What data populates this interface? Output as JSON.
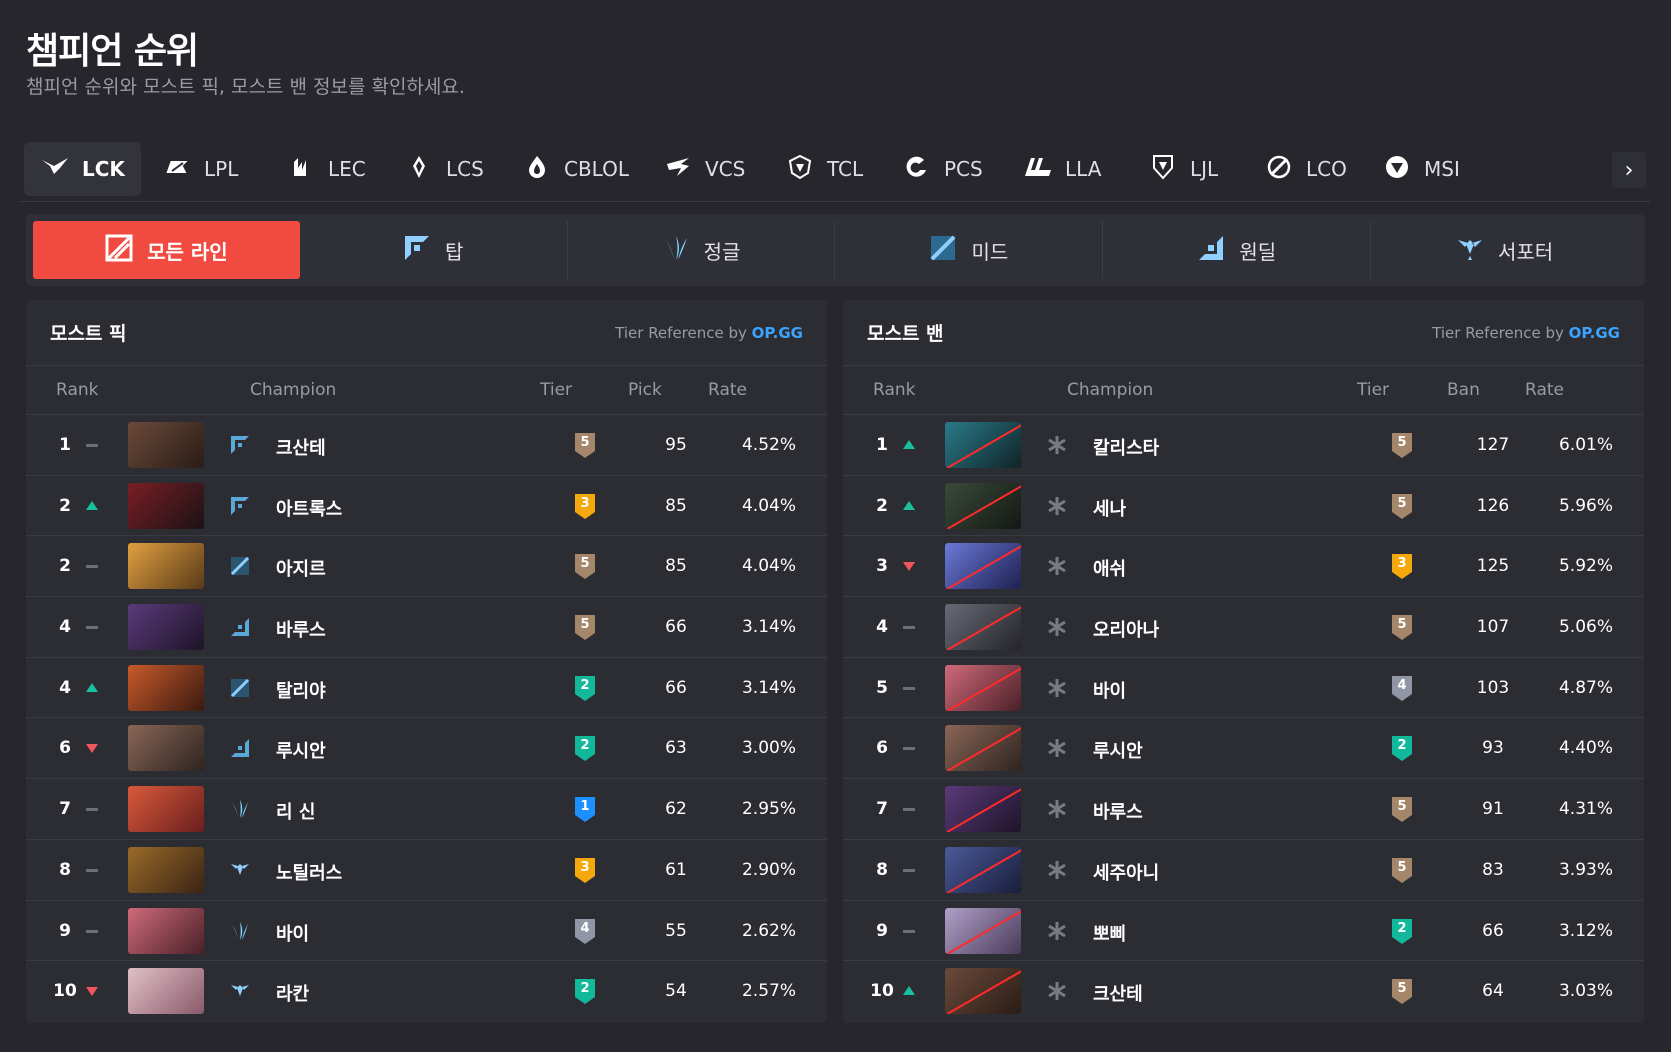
{
  "page": {
    "title": "챔피언 순위",
    "subtitle": "챔피언 순위와 모스트 픽, 모스트 밴 정보를 확인하세요."
  },
  "leagues": [
    {
      "label": "LCK",
      "icon": "lck-icon",
      "active": true
    },
    {
      "label": "LPL",
      "icon": "lpl-icon"
    },
    {
      "label": "LEC",
      "icon": "lec-icon"
    },
    {
      "label": "LCS",
      "icon": "lcs-icon"
    },
    {
      "label": "CBLOL",
      "icon": "cblol-icon"
    },
    {
      "label": "VCS",
      "icon": "vcs-icon"
    },
    {
      "label": "TCL",
      "icon": "tcl-icon"
    },
    {
      "label": "PCS",
      "icon": "pcs-icon"
    },
    {
      "label": "LLA",
      "icon": "lla-icon"
    },
    {
      "label": "LJL",
      "icon": "ljl-icon"
    },
    {
      "label": "LCO",
      "icon": "lco-icon"
    },
    {
      "label": "MSI",
      "icon": "msi-icon"
    }
  ],
  "lanes": [
    {
      "label": "모든 라인",
      "icon": "all-lanes-icon",
      "active": true
    },
    {
      "label": "탑",
      "icon": "top-lane-icon"
    },
    {
      "label": "정글",
      "icon": "jungle-icon"
    },
    {
      "label": "미드",
      "icon": "mid-lane-icon"
    },
    {
      "label": "원딜",
      "icon": "bot-lane-icon"
    },
    {
      "label": "서포터",
      "icon": "support-icon"
    }
  ],
  "tier_colors": {
    "1": "#1e8fff",
    "2": "#12b89a",
    "3": "#f5a80b",
    "4": "#9096a5",
    "5": "#a4876a"
  },
  "most_pick": {
    "title": "모스트 픽",
    "tier_ref_prefix": "Tier Reference by",
    "tier_ref_brand": "OP.GG",
    "columns": {
      "rank": "Rank",
      "champion": "Champion",
      "tier": "Tier",
      "count": "Pick",
      "rate": "Rate"
    },
    "rows": [
      {
        "rank": "1",
        "trend": "same",
        "position": "top",
        "champion": "크산테",
        "tier": "5",
        "count": "95",
        "rate": "4.52%"
      },
      {
        "rank": "2",
        "trend": "up",
        "position": "top",
        "champion": "아트록스",
        "tier": "3",
        "count": "85",
        "rate": "4.04%"
      },
      {
        "rank": "2",
        "trend": "same",
        "position": "mid",
        "champion": "아지르",
        "tier": "5",
        "count": "85",
        "rate": "4.04%"
      },
      {
        "rank": "4",
        "trend": "same",
        "position": "bot",
        "champion": "바루스",
        "tier": "5",
        "count": "66",
        "rate": "3.14%"
      },
      {
        "rank": "4",
        "trend": "up",
        "position": "mid",
        "champion": "탈리야",
        "tier": "2",
        "count": "66",
        "rate": "3.14%"
      },
      {
        "rank": "6",
        "trend": "down",
        "position": "bot",
        "champion": "루시안",
        "tier": "2",
        "count": "63",
        "rate": "3.00%"
      },
      {
        "rank": "7",
        "trend": "same",
        "position": "jungle",
        "champion": "리 신",
        "tier": "1",
        "count": "62",
        "rate": "2.95%"
      },
      {
        "rank": "8",
        "trend": "same",
        "position": "support",
        "champion": "노틸러스",
        "tier": "3",
        "count": "61",
        "rate": "2.90%"
      },
      {
        "rank": "9",
        "trend": "same",
        "position": "jungle",
        "champion": "바이",
        "tier": "4",
        "count": "55",
        "rate": "2.62%"
      },
      {
        "rank": "10",
        "trend": "down",
        "position": "support",
        "champion": "라칸",
        "tier": "2",
        "count": "54",
        "rate": "2.57%"
      }
    ]
  },
  "most_ban": {
    "title": "모스트 밴",
    "tier_ref_prefix": "Tier Reference by",
    "tier_ref_brand": "OP.GG",
    "columns": {
      "rank": "Rank",
      "champion": "Champion",
      "tier": "Tier",
      "count": "Ban",
      "rate": "Rate"
    },
    "rows": [
      {
        "rank": "1",
        "trend": "up",
        "position": "all",
        "champion": "칼리스타",
        "tier": "5",
        "count": "127",
        "rate": "6.01%"
      },
      {
        "rank": "2",
        "trend": "up",
        "position": "all",
        "champion": "세나",
        "tier": "5",
        "count": "126",
        "rate": "5.96%"
      },
      {
        "rank": "3",
        "trend": "down",
        "position": "all",
        "champion": "애쉬",
        "tier": "3",
        "count": "125",
        "rate": "5.92%"
      },
      {
        "rank": "4",
        "trend": "same",
        "position": "all",
        "champion": "오리아나",
        "tier": "5",
        "count": "107",
        "rate": "5.06%"
      },
      {
        "rank": "5",
        "trend": "same",
        "position": "all",
        "champion": "바이",
        "tier": "4",
        "count": "103",
        "rate": "4.87%"
      },
      {
        "rank": "6",
        "trend": "same",
        "position": "all",
        "champion": "루시안",
        "tier": "2",
        "count": "93",
        "rate": "4.40%"
      },
      {
        "rank": "7",
        "trend": "same",
        "position": "all",
        "champion": "바루스",
        "tier": "5",
        "count": "91",
        "rate": "4.31%"
      },
      {
        "rank": "8",
        "trend": "same",
        "position": "all",
        "champion": "세주아니",
        "tier": "5",
        "count": "83",
        "rate": "3.93%"
      },
      {
        "rank": "9",
        "trend": "same",
        "position": "all",
        "champion": "뽀삐",
        "tier": "2",
        "count": "66",
        "rate": "3.12%"
      },
      {
        "rank": "10",
        "trend": "up",
        "position": "all",
        "champion": "크산테",
        "tier": "5",
        "count": "64",
        "rate": "3.03%"
      }
    ]
  }
}
